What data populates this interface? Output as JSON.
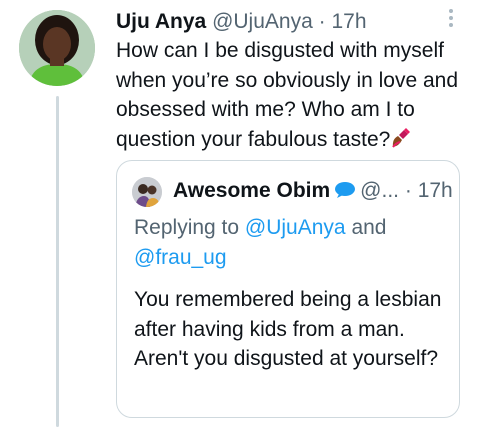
{
  "tweet": {
    "author_name": "Uju Anya",
    "author_handle": "@UjuAnya",
    "separator": "·",
    "time": "17h",
    "text": "How can I be disgusted with myself when you’re so obviously in love and obsessed with me? Who am I to question your fabulous taste?",
    "emoji": "nail-polish-icon"
  },
  "quoted": {
    "author_name": "Awesome Obim",
    "author_handle": "@...",
    "separator": "·",
    "time": "17h",
    "replying_prefix": "Replying to",
    "replying_to_1": "@UjuAnya",
    "replying_and": "and",
    "replying_to_2": "@frau_ug",
    "text": "You remembered being a lesbian after having kids from a man. Aren't you disgusted at yourself?"
  },
  "colors": {
    "text": "#0f1419",
    "secondary": "#536471",
    "link": "#1d9bf0",
    "border": "#cfd9de",
    "thread_line": "#cfd9de"
  }
}
